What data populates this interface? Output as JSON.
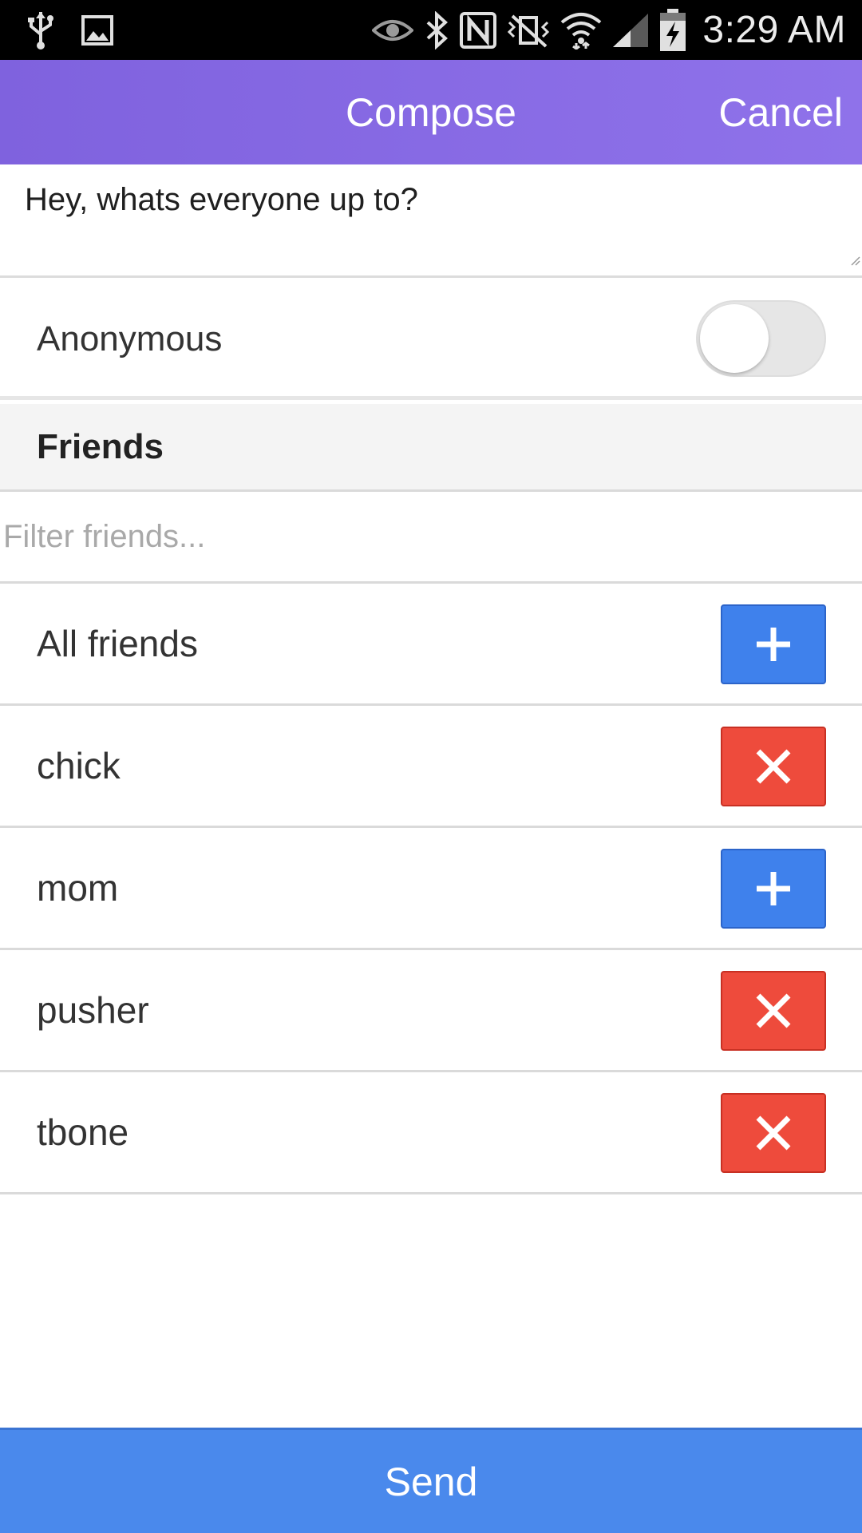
{
  "status_bar": {
    "time": "3:29 AM",
    "left_icons": [
      "usb-icon",
      "image-icon"
    ],
    "right_icons": [
      "eye-icon",
      "bluetooth-icon",
      "nfc-icon",
      "vibrate-icon",
      "wifi-icon",
      "signal-icon",
      "battery-charging-icon"
    ]
  },
  "header": {
    "title": "Compose",
    "cancel_label": "Cancel",
    "background": "#8568e3"
  },
  "message": {
    "text": "Hey, whats everyone up to?"
  },
  "anonymous": {
    "label": "Anonymous",
    "enabled": false
  },
  "friends": {
    "title": "Friends",
    "filter_placeholder": "Filter friends...",
    "filter_value": "",
    "items": [
      {
        "name": "All friends",
        "action": "add"
      },
      {
        "name": "chick",
        "action": "remove"
      },
      {
        "name": "mom",
        "action": "add"
      },
      {
        "name": "pusher",
        "action": "remove"
      },
      {
        "name": "tbone",
        "action": "remove"
      }
    ]
  },
  "send": {
    "label": "Send"
  },
  "colors": {
    "add_button": "#3f81ec",
    "remove_button": "#ee4b3c",
    "send_bar": "#4a89ec"
  }
}
